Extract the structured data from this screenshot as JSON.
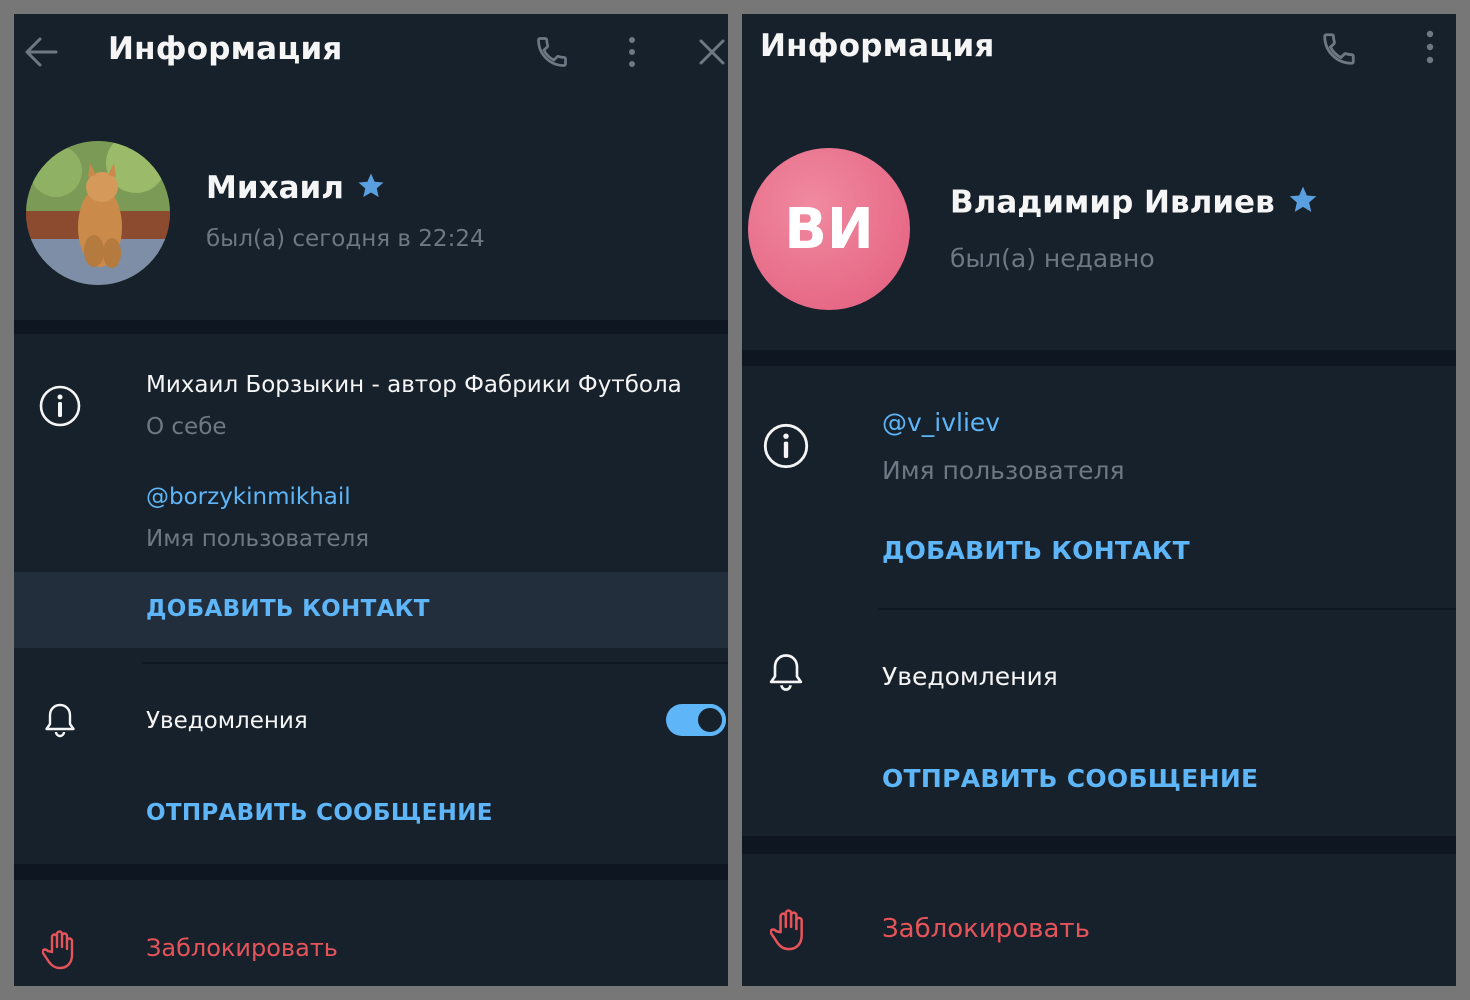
{
  "colors": {
    "background": "#17212b",
    "separator": "#0e1621",
    "accent": "#5eb5f7",
    "star": "#5a9fe0",
    "danger": "#e5545a",
    "secondary_text": "#6d7883",
    "avatar_pink": "#ed6d8c"
  },
  "left": {
    "header": {
      "title": "Информация"
    },
    "profile": {
      "name": "Михаил",
      "status": "был(а) сегодня в 22:24"
    },
    "bio": {
      "value": "Михаил Борзыкин - автор Фабрики Футбола",
      "label": "О себе"
    },
    "username": {
      "value": "@borzykinmikhail",
      "label": "Имя пользователя"
    },
    "add_contact": "ДОБАВИТЬ КОНТАКТ",
    "notifications": {
      "label": "Уведомления",
      "enabled": true
    },
    "send_message": "ОТПРАВИТЬ СООБЩЕНИЕ",
    "block": "Заблокировать"
  },
  "right": {
    "header": {
      "title": "Информация"
    },
    "profile": {
      "initials": "ВИ",
      "name": "Владимир Ивлиев",
      "status": "был(а) недавно"
    },
    "username": {
      "value": "@v_ivliev",
      "label": "Имя пользователя"
    },
    "add_contact": "ДОБАВИТЬ КОНТАКТ",
    "notifications": {
      "label": "Уведомления"
    },
    "send_message": "ОТПРАВИТЬ СООБЩЕНИЕ",
    "block": "Заблокировать"
  }
}
